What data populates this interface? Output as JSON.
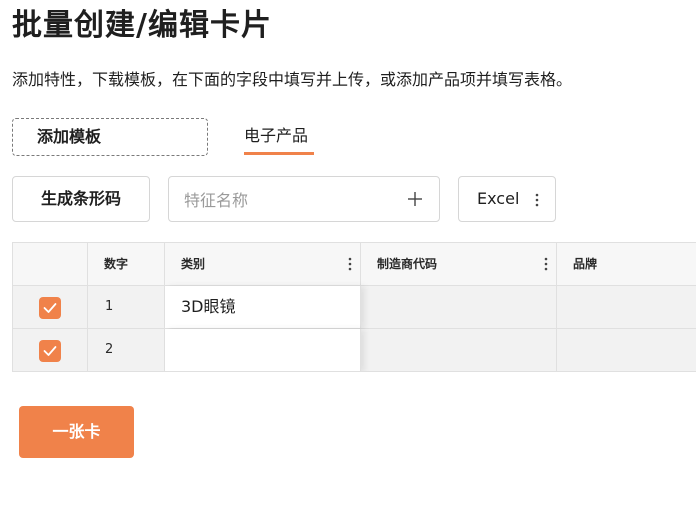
{
  "page": {
    "title": "批量创建/编辑卡片",
    "description": "添加特性，下载模板，在下面的字段中填写并上传，或添加产品项并填写表格。"
  },
  "toolbar": {
    "add_template_label": "添加模板",
    "tab_label": "电子产品",
    "barcode_label": "生成条形码",
    "feature_placeholder": "特征名称",
    "excel_label": "Excel"
  },
  "table": {
    "columns": [
      "",
      "数字",
      "类别",
      "制造商代码",
      "品牌"
    ],
    "rows": [
      {
        "checked": true,
        "number": "1",
        "category": "3D眼镜",
        "manufacturer_code": "",
        "brand": ""
      },
      {
        "checked": true,
        "number": "2",
        "category": "",
        "manufacturer_code": "",
        "brand": ""
      }
    ]
  },
  "footer": {
    "add_card_label": "一张卡"
  },
  "colors": {
    "accent": "#f0824a",
    "border": "#e0e0e0"
  },
  "icons": {
    "plus": "plus-icon",
    "kebab": "kebab-icon",
    "check": "check-icon"
  }
}
